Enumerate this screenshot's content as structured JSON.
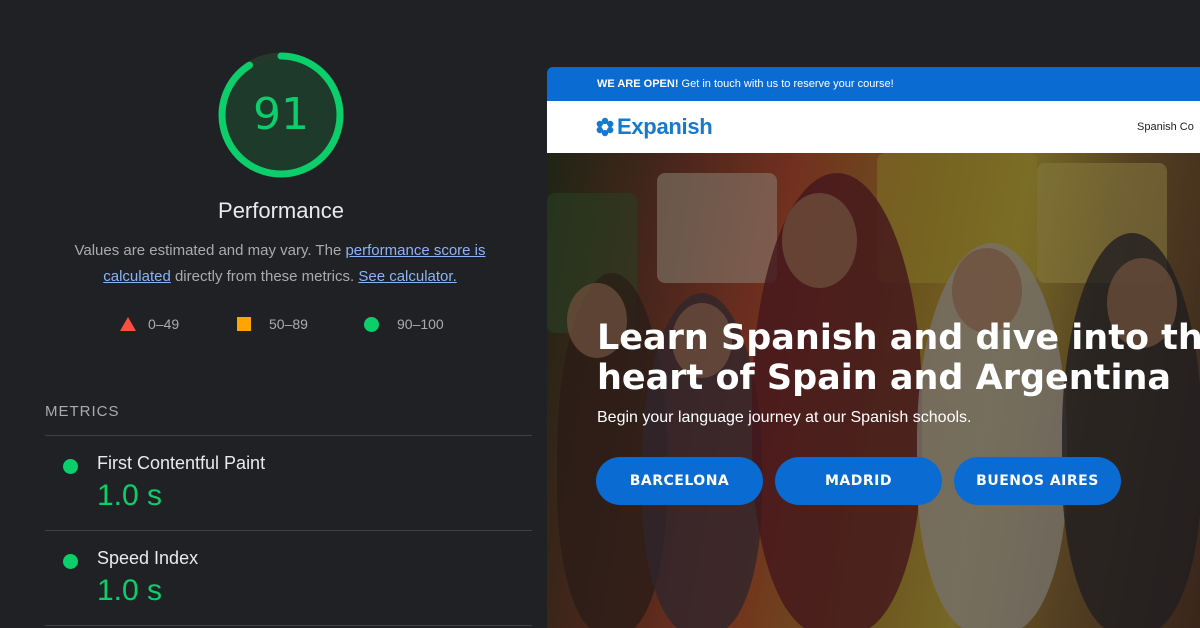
{
  "lighthouse": {
    "score": "91",
    "score_fraction": 0.91,
    "title": "Performance",
    "description": {
      "text1": "Values are estimated and may vary. The ",
      "link1": "performance score is calculated",
      "text2": " directly from these metrics. ",
      "link2": "See calculator."
    },
    "legend": [
      {
        "label": "0–49",
        "icon": "triangle-icon",
        "color": "#ff4e42"
      },
      {
        "label": "50–89",
        "icon": "square-icon",
        "color": "#ffa400"
      },
      {
        "label": "90–100",
        "icon": "circle-icon",
        "color": "#0cce6b"
      }
    ],
    "metrics_heading": "METRICS",
    "metrics": [
      {
        "label": "First Contentful Paint",
        "value": "1.0 s"
      },
      {
        "label": "Speed Index",
        "value": "1.0 s"
      }
    ]
  },
  "site": {
    "topbar": {
      "bold": "WE ARE OPEN!",
      "text": " Get in touch with us to reserve your course!"
    },
    "logo": "Expanish",
    "nav_link": "Spanish Co",
    "hero": {
      "title_line1": "Learn Spanish and dive into th",
      "title_line2": "heart of Spain and Argentina",
      "subtitle": "Begin your language journey at our Spanish schools.",
      "buttons": [
        "BARCELONA",
        "MADRID",
        "BUENOS AIRES"
      ]
    },
    "colors": {
      "brand_blue": "#0a6bd2",
      "good_green": "#0cce6b"
    }
  }
}
